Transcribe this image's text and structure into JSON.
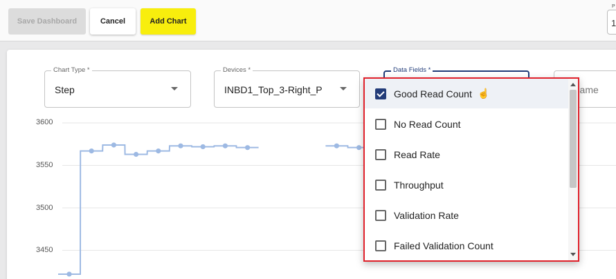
{
  "toolbar": {
    "save_label": "Save Dashboard",
    "cancel_label": "Cancel",
    "add_chart_label": "Add Chart",
    "cut_field_label": "P",
    "cut_field_value": "1"
  },
  "form": {
    "chart_type": {
      "label": "Chart Type *",
      "value": "Step"
    },
    "devices": {
      "label": "Devices *",
      "value": "INBD1_Top_3-Right_P"
    },
    "data_fields": {
      "label": "Data Fields *"
    },
    "chart_name": {
      "placeholder": "rt Name"
    }
  },
  "dropdown": {
    "options": [
      {
        "label": "Good Read Count",
        "checked": true
      },
      {
        "label": "No Read Count",
        "checked": false
      },
      {
        "label": "Read Rate",
        "checked": false
      },
      {
        "label": "Throughput",
        "checked": false
      },
      {
        "label": "Validation Rate",
        "checked": false
      },
      {
        "label": "Failed Validation Count",
        "checked": false
      }
    ]
  },
  "colors": {
    "accent": "#233c79",
    "add_button": "#f8ee0d",
    "highlight_border": "#e0202a",
    "series": "#9db9e3"
  },
  "chart_data": {
    "type": "line",
    "step": true,
    "yticks": [
      "3600",
      "3550",
      "3500",
      "3450"
    ],
    "ylim": [
      3420,
      3600
    ],
    "grid": true,
    "series": [
      {
        "x": [
          1,
          2,
          3,
          4,
          5,
          6,
          7,
          8,
          9,
          10,
          11,
          12,
          13,
          14
        ],
        "values": [
          3422,
          3567,
          3574,
          3563,
          3567,
          3573,
          3572,
          3573,
          3571,
          null,
          null,
          null,
          3573,
          3571
        ]
      }
    ]
  }
}
